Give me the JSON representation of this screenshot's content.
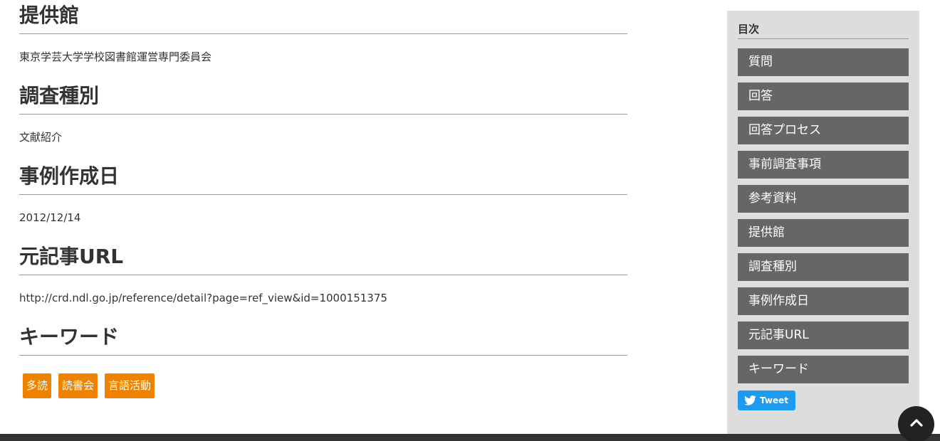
{
  "sections": [
    {
      "heading": "提供館",
      "body": "東京学芸大学学校図書館運営専門委員会"
    },
    {
      "heading": "調査種別",
      "body": "文献紹介"
    },
    {
      "heading": "事例作成日",
      "body": "2012/12/14"
    },
    {
      "heading": "元記事URL",
      "body": "http://crd.ndl.go.jp/reference/detail?page=ref_view&id=1000151375"
    },
    {
      "heading": "キーワード"
    }
  ],
  "keywords": [
    "多読",
    "読書会",
    "言語活動"
  ],
  "toc": {
    "title": "目次",
    "items": [
      "質問",
      "回答",
      "回答プロセス",
      "事前調査事項",
      "参考資料",
      "提供館",
      "調査種別",
      "事例作成日",
      "元記事URL",
      "キーワード"
    ]
  },
  "tweet": {
    "label": "Tweet",
    "icon": "twitter-bird-icon"
  },
  "back_to_top": {
    "icon": "chevron-up-icon"
  },
  "colors": {
    "tag": "#ef8200",
    "toc_item": "#666666",
    "sidebar": "#dddddd",
    "tweet": "#1d9bf0",
    "footer": "#333333"
  }
}
